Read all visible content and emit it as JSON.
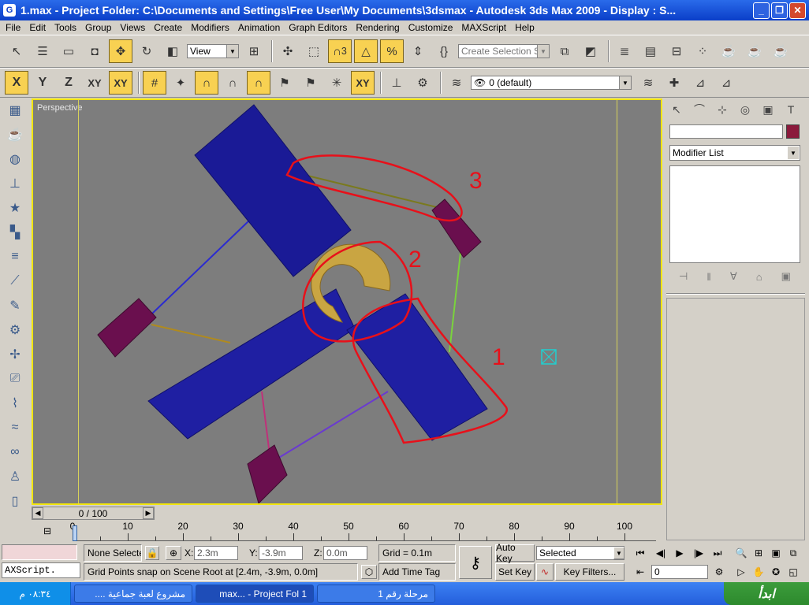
{
  "window": {
    "title": "1.max    - Project Folder: C:\\Documents and Settings\\Free User\\My Documents\\3dsmax     - Autodesk 3ds Max  2009       - Display : S..."
  },
  "menu": [
    "File",
    "Edit",
    "Tools",
    "Group",
    "Views",
    "Create",
    "Modifiers",
    "Animation",
    "Graph Editors",
    "Rendering",
    "Customize",
    "MAXScript",
    "Help"
  ],
  "toolbar": {
    "ref_coord": "View",
    "selection_set_placeholder": "Create Selection Set",
    "axis": {
      "x": "X",
      "y": "Y",
      "z": "Z",
      "xy": "XY",
      "xy2": "XY"
    },
    "snap3": "3",
    "layer": "0 (default)"
  },
  "viewport": {
    "label": "Perspective"
  },
  "annotations": [
    "1",
    "2",
    "3"
  ],
  "command_panel": {
    "modifier_list": "Modifier List"
  },
  "timeline": {
    "frame_display": "0 / 100",
    "ticks": [
      "0",
      "10",
      "20",
      "30",
      "40",
      "50",
      "60",
      "70",
      "80",
      "90",
      "100"
    ]
  },
  "status": {
    "selection": "None Selecte",
    "x_label": "X:",
    "x_value": "2.3m",
    "y_label": "Y:",
    "y_value": "-3.9m",
    "z_label": "Z:",
    "z_value": "0.0m",
    "grid": "Grid = 0.1m",
    "auto_key": "Auto Key",
    "set_key": "Set Key",
    "key_mode": "Selected",
    "key_filters": "Key Filters...",
    "frame": "0",
    "maxscript": "AXScript.",
    "prompt": "Grid Points snap on Scene Root at [2.4m, -3.9m, 0.0m]",
    "add_time_tag": "Add Time Tag"
  },
  "taskbar": {
    "clock": "٠٨:٣٤ م",
    "tasks": [
      "مشروع لعبة جماعية ....",
      "max... - Project Fol 1",
      "مرحلة رقم 1"
    ],
    "start": "ابدأ"
  }
}
